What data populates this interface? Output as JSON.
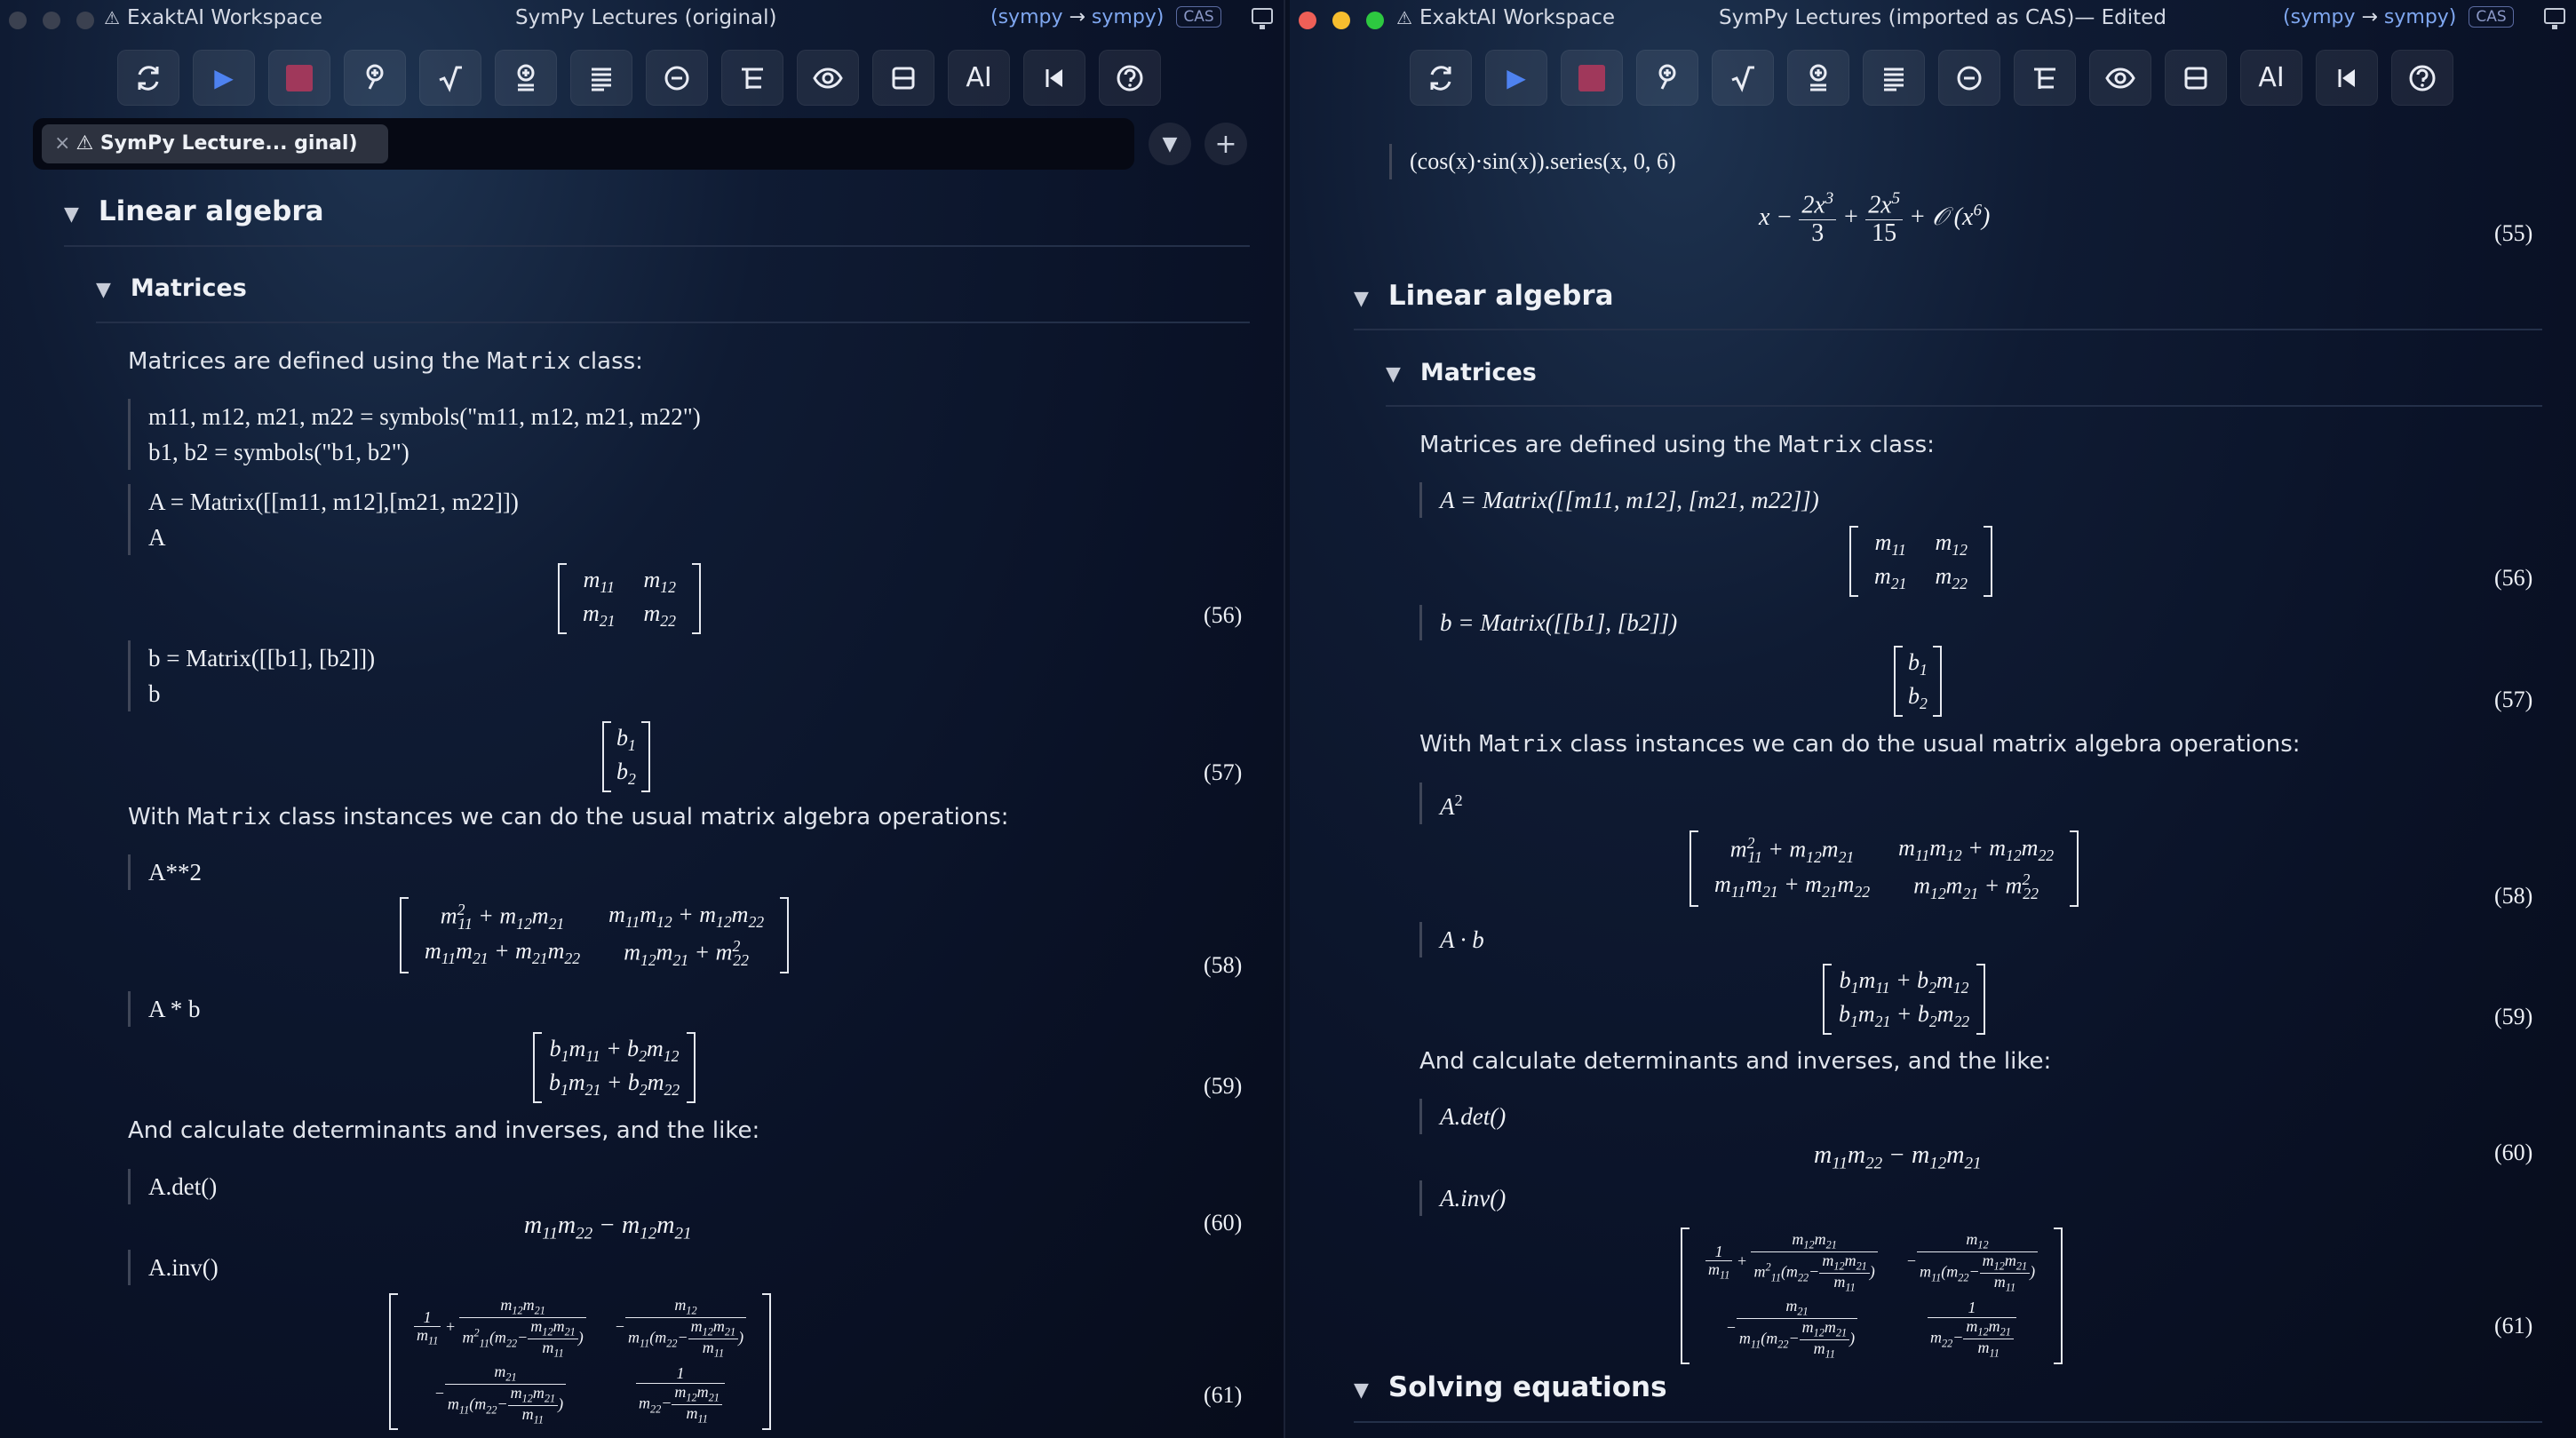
{
  "left": {
    "workspace": "ExaktAI Workspace",
    "title": "SymPy Lectures (original)",
    "kernel_open": "(sympy",
    "kernel_arrow": " → ",
    "kernel_close": "sympy)",
    "cas_badge": "CAS",
    "tab_label": "SymPy Lecture... ginal)",
    "tab_close": "×",
    "section_linear": "Linear algebra",
    "subsection_matrices": "Matrices",
    "p1_pre": "Matrices are defined using the ",
    "p1_code": "Matrix",
    "p1_post": " class:",
    "code1_l1": "m11, m12, m21, m22 = symbols(\"m11, m12, m21, m22\")",
    "code1_l2": "b1, b2 = symbols(\"b1, b2\")",
    "code2_l1": "A = Matrix([[m11, m12],[m21, m22]])",
    "code2_l2": "A",
    "eq56": "(56)",
    "code3_l1": "b = Matrix([[b1], [b2]])",
    "code3_l2": "b",
    "eq57": "(57)",
    "p2_pre": "With ",
    "p2_code": "Matrix",
    "p2_post": " class instances we can do the usual matrix algebra operations:",
    "code4": "A**2",
    "eq58": "(58)",
    "code5": "A * b",
    "eq59": "(59)",
    "p3": "And calculate determinants and inverses, and the like:",
    "code6": "A.det()",
    "eq60": "(60)",
    "code7": "A.inv()",
    "eq61": "(61)"
  },
  "right": {
    "workspace": "ExaktAI Workspace",
    "title": "SymPy Lectures (imported as CAS)— Edited",
    "kernel_open": "(sympy",
    "kernel_arrow": " → ",
    "kernel_close": "sympy)",
    "cas_badge": "CAS",
    "series_code": "(cos(x)·sin(x)).series(x, 0, 6)",
    "eq55": "(55)",
    "section_linear": "Linear algebra",
    "subsection_matrices": "Matrices",
    "p1_pre": "Matrices are defined using the ",
    "p1_code": "Matrix",
    "p1_post": " class:",
    "code1": "A = Matrix([[m11, m12], [m21, m22]])",
    "eq56": "(56)",
    "code2": "b = Matrix([[b1], [b2]])",
    "eq57": "(57)",
    "p2_pre": "With ",
    "p2_code": "Matrix",
    "p2_post": " class instances we can do the usual matrix algebra operations:",
    "eq58": "(58)",
    "code4": "A · b",
    "eq59": "(59)",
    "p3": "And calculate determinants and inverses, and the like:",
    "code5": "A.det()",
    "eq60": "(60)",
    "code6": "A.inv()",
    "eq61": "(61)",
    "section_solving": "Solving equations"
  },
  "toolbar_icons": [
    "restart-icon",
    "run-icon",
    "stop-icon",
    "inspect-icon",
    "sqrt-icon",
    "insert-math-icon",
    "align-icon",
    "minus-circle-icon",
    "outline-icon",
    "eye-icon",
    "split-icon",
    "ai-icon",
    "skip-back-icon",
    "help-icon"
  ],
  "toolbar_ai_label": "AI",
  "colors": {
    "accent": "#4e82f0",
    "stop": "#a0385b",
    "kernel": "#7fa7f0"
  }
}
